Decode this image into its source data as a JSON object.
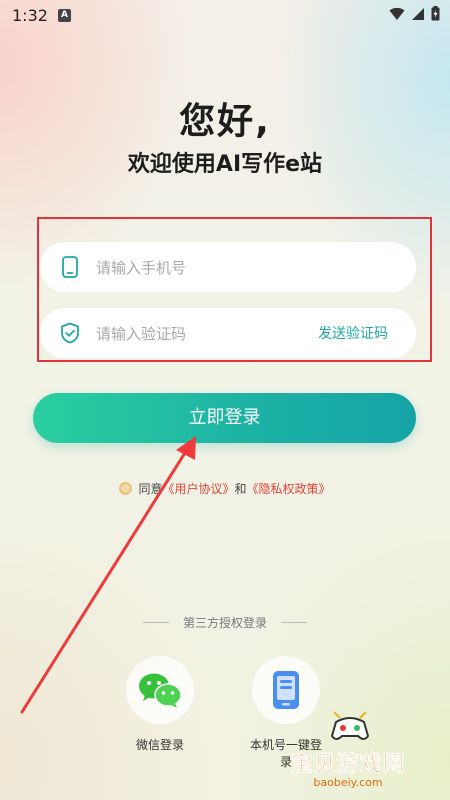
{
  "status_bar": {
    "time": "1:32",
    "app_indicator": "A"
  },
  "header": {
    "greeting": "您好,",
    "welcome": "欢迎使用AI写作e站"
  },
  "form": {
    "phone_placeholder": "请输入手机号",
    "code_placeholder": "请输入验证码",
    "send_code_label": "发送验证码"
  },
  "login_button": {
    "label": "立即登录"
  },
  "agreement": {
    "prefix": "同意",
    "user_agreement": "《用户协议》",
    "and": "和",
    "privacy_policy": "《隐私权政策》"
  },
  "third_party": {
    "title": "第三方授权登录",
    "items": [
      {
        "label": "微信登录",
        "icon": "wechat-icon"
      },
      {
        "label": "本机号一键登录",
        "icon": "phone-number-icon"
      }
    ]
  },
  "watermark": {
    "text": "宝贝游戏网",
    "url": "baobeiy.com"
  },
  "colors": {
    "accent": "#1fa7a3",
    "login_gradient_start": "#2bcfa0",
    "login_gradient_end": "#16a3a7",
    "highlight_box": "#e0343c",
    "link": "#e04437"
  }
}
